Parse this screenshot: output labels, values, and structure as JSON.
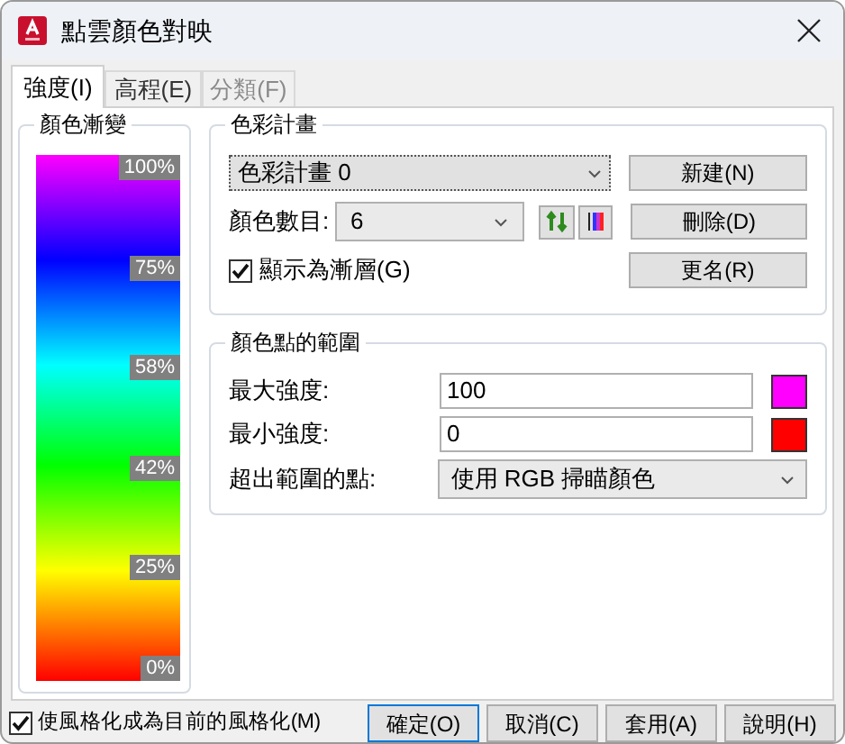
{
  "window": {
    "title": "點雲顏色對映"
  },
  "tabs": [
    {
      "label": "強度(I)",
      "selected": true,
      "disabled": false
    },
    {
      "label": "高程(E)",
      "selected": false,
      "disabled": false
    },
    {
      "label": "分類(F)",
      "selected": false,
      "disabled": true
    }
  ],
  "gradient": {
    "title": "顏色漸變",
    "ticks": [
      "100%",
      "75%",
      "58%",
      "42%",
      "25%",
      "0%"
    ]
  },
  "scheme": {
    "title": "色彩計畫",
    "scheme_value": "色彩計畫 0",
    "count_label": "顏色數目:",
    "count_value": "6",
    "show_gradient": {
      "label": "顯示為漸層(G)",
      "checked": true
    },
    "buttons": [
      "新建(N)",
      "刪除(D)",
      "更名(R)"
    ]
  },
  "range": {
    "title": "顏色點的範圍",
    "max": {
      "label": "最大強度:",
      "value": "100",
      "color": "#ff00ff"
    },
    "min": {
      "label": "最小強度:",
      "value": "0",
      "color": "#ff0000"
    },
    "outside": {
      "label": "超出範圍的點:",
      "value": "使用 RGB 掃瞄顏色"
    }
  },
  "footer": {
    "make_current": {
      "label": "使風格化成為目前的風格化(M)",
      "checked": true
    },
    "buttons": [
      {
        "label": "確定(O)",
        "selected": true
      },
      {
        "label": "取消(C)",
        "selected": false
      },
      {
        "label": "套用(A)",
        "selected": false
      },
      {
        "label": "說明(H)",
        "selected": false
      }
    ]
  }
}
